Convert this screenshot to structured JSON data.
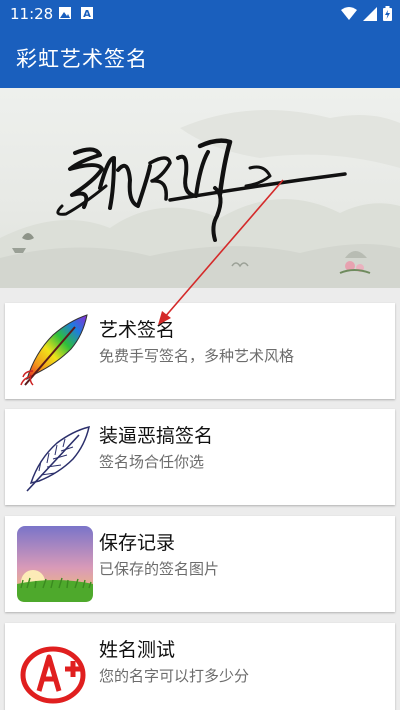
{
  "status_bar": {
    "time": "11:28",
    "icons": [
      "image-icon",
      "a-icon",
      "wifi-icon",
      "signal-icon",
      "battery-icon"
    ]
  },
  "app_bar": {
    "title": "彩虹艺术签名"
  },
  "banner": {
    "dots": 1,
    "icons": [
      "signature-banner-image",
      "red-arrow-annotation"
    ]
  },
  "menu": {
    "items": [
      {
        "title": "艺术签名",
        "subtitle": "免费手写签名，多种艺术风格",
        "icon": "rainbow-feather-icon"
      },
      {
        "title": "装逼恶搞签名",
        "subtitle": "签名场合任你选",
        "icon": "feather-sketch-icon"
      },
      {
        "title": "保存记录",
        "subtitle": "已保存的签名图片",
        "icon": "sunset-grass-icon"
      },
      {
        "title": "姓名测试",
        "subtitle": "您的名字可以打多少分",
        "icon": "a-plus-icon"
      }
    ]
  },
  "colors": {
    "primary": "#1a5fbd",
    "arrow": "#d42a2a"
  }
}
